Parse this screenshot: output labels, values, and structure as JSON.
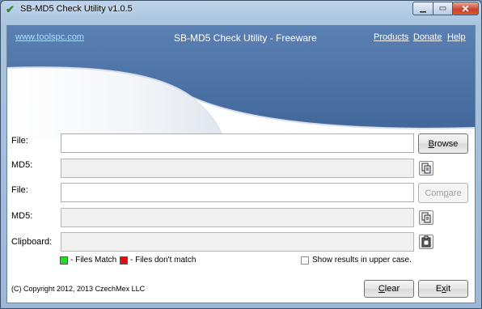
{
  "window": {
    "title": "SB-MD5 Check Utility  v1.0.5",
    "minimize_glyph": "▁",
    "maximize_glyph": "▭",
    "close_glyph": "✕"
  },
  "banner": {
    "website": "www.toolspc.com",
    "title": "SB-MD5 Check Utility - Freeware",
    "links": {
      "products": "Products",
      "donate": "Donate",
      "help": "Help"
    }
  },
  "form": {
    "file1_label": "File:",
    "md5_1_label": "MD5:",
    "file2_label": "File:",
    "md5_2_label": "MD5:",
    "clipboard_label": "Clipboard:",
    "file1_value": "",
    "md5_1_value": "",
    "file2_value": "",
    "md5_2_value": "",
    "clipboard_value": ""
  },
  "buttons": {
    "browse": {
      "mnemonic": "B",
      "rest": "rowse"
    },
    "compare": {
      "pre": "Com",
      "mnemonic": "p",
      "rest": "are"
    },
    "clear": {
      "mnemonic": "C",
      "rest": "lear"
    },
    "exit": {
      "pre": "E",
      "mnemonic": "x",
      "rest": "it"
    }
  },
  "legend": {
    "match": "- Files Match",
    "nomatch": "- Files don't match",
    "match_color": "#22dd22",
    "nomatch_color": "#dd1111"
  },
  "options": {
    "uppercase_label": "Show results in upper case.",
    "uppercase_checked": false
  },
  "footer": {
    "copyright": "(C) Copyright 2012, 2013 CzechMex LLC"
  },
  "icons": {
    "app": "check-icon",
    "copy": "copy-icon",
    "paste": "paste-icon"
  },
  "colors": {
    "banner_blue": "#4a6fa5"
  }
}
